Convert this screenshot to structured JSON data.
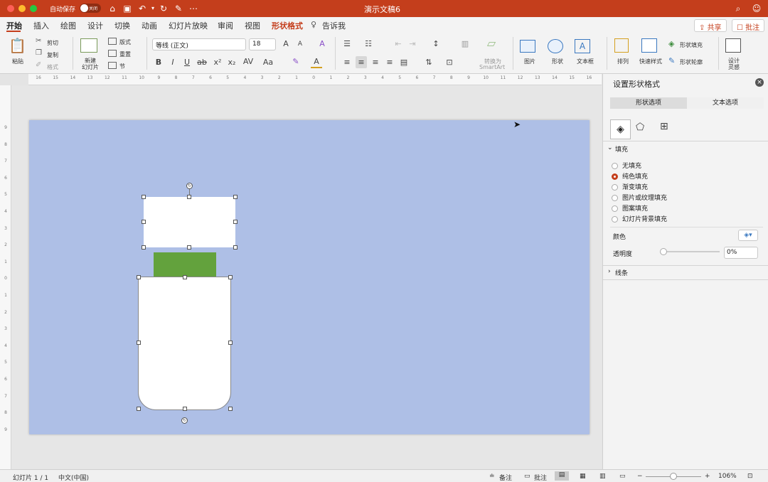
{
  "window": {
    "title": "演示文稿6",
    "autosave_label": "自动保存",
    "autosave_state": "关闭"
  },
  "tabs": [
    "开始",
    "插入",
    "绘图",
    "设计",
    "切换",
    "动画",
    "幻灯片放映",
    "审阅",
    "视图",
    "形状格式",
    "告诉我"
  ],
  "top_actions": {
    "share": "共享",
    "comments": "批注"
  },
  "ribbon": {
    "paste": "粘贴",
    "cut": "剪切",
    "copy": "复制",
    "format": "格式",
    "new_slide_line1": "新建",
    "new_slide_line2": "幻灯片",
    "layout": "版式",
    "reset": "重置",
    "section": "节",
    "font_name": "等线 (正文)",
    "font_size": "18",
    "convert_smartart_line1": "转换为",
    "convert_smartart_line2": "SmartArt",
    "picture": "图片",
    "shape": "形状",
    "textbox": "文本框",
    "arrange": "排列",
    "quick_styles": "快速样式",
    "shape_fill": "形状填充",
    "shape_outline": "形状轮廓",
    "design_ideas_line1": "设计",
    "design_ideas_line2": "灵感"
  },
  "ruler_h_labels": [
    "16",
    "15",
    "14",
    "13",
    "12",
    "11",
    "10",
    "9",
    "8",
    "7",
    "6",
    "5",
    "4",
    "3",
    "2",
    "1",
    "0",
    "1",
    "2",
    "3",
    "4",
    "5",
    "6",
    "7",
    "8",
    "9",
    "10",
    "11",
    "12",
    "13",
    "14",
    "15",
    "16"
  ],
  "ruler_v_labels": [
    "9",
    "8",
    "7",
    "6",
    "5",
    "4",
    "3",
    "2",
    "1",
    "0",
    "1",
    "2",
    "3",
    "4",
    "5",
    "6",
    "7",
    "8",
    "9"
  ],
  "pane": {
    "title": "设置形状格式",
    "tab_shape": "形状选项",
    "tab_text": "文本选项",
    "fill_section": "填充",
    "fill_options": [
      "无填充",
      "纯色填充",
      "渐变填充",
      "图片或纹理填充",
      "图案填充",
      "幻灯片背景填充"
    ],
    "selected_fill": 1,
    "color_label": "颜色",
    "transparency_label": "透明度",
    "transparency_value": "0%",
    "line_section": "线条"
  },
  "status": {
    "slide_info": "幻灯片 1 / 1",
    "language": "中文(中国)",
    "notes": "备注",
    "comments": "批注",
    "zoom": "106%"
  },
  "colors": {
    "accent": "#c43e1c",
    "slide_bg": "#aebfe6",
    "green_shape": "#63a23d",
    "white_shape": "#ffffff"
  }
}
